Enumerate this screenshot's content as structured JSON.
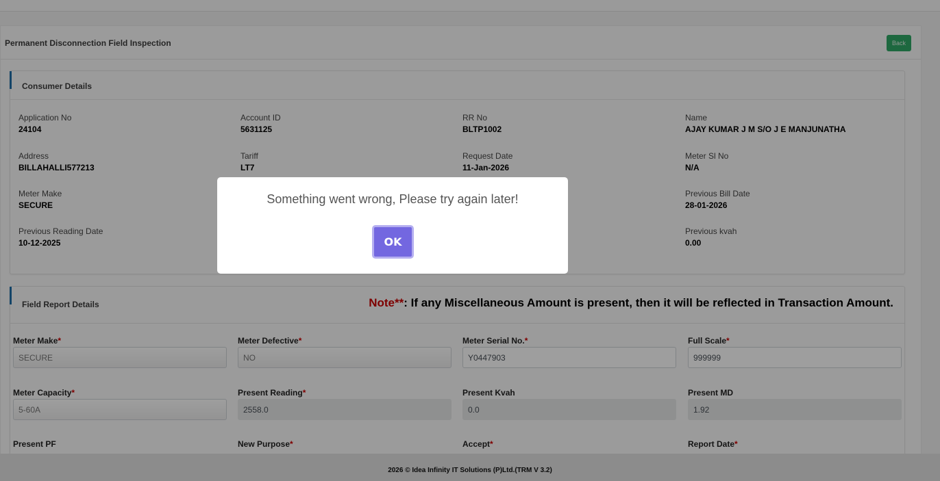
{
  "page": {
    "title": "Permanent Disconnection Field Inspection",
    "back_label": "Back"
  },
  "consumer": {
    "title": "Consumer Details",
    "fields": [
      {
        "label": "Application No",
        "value": "24104"
      },
      {
        "label": "Account ID",
        "value": "5631125"
      },
      {
        "label": "RR No",
        "value": "BLTP1002"
      },
      {
        "label": "Name",
        "value": "AJAY KUMAR J M S/O J E MANJUNATHA"
      },
      {
        "label": "Address",
        "value": "BILLAHALLI577213"
      },
      {
        "label": "Tariff",
        "value": "LT7"
      },
      {
        "label": "Request Date",
        "value": "11-Jan-2026"
      },
      {
        "label": "Meter Sl No",
        "value": "N/A"
      },
      {
        "label": "Meter Make",
        "value": "SECURE"
      },
      {
        "label": "Previous Bill Date",
        "value": "28-01-2026"
      },
      {
        "label": "Previous Reading Date",
        "value": "10-12-2025"
      },
      {
        "label": "Previous kvah",
        "value": "0.00"
      }
    ]
  },
  "field_report": {
    "title": "Field Report Details",
    "note_prefix": "Note**",
    "note_text": ": If any Miscellaneous Amount is present, then it will be reflected in Transaction Amount.",
    "fields": [
      {
        "label": "Meter Make",
        "req": "*",
        "value": "SECURE"
      },
      {
        "label": "Meter Defective",
        "req": "*",
        "value": "NO"
      },
      {
        "label": "Meter Serial No.",
        "req": "*",
        "value": "Y0447903"
      },
      {
        "label": "Full Scale",
        "req": "*",
        "value": "999999"
      },
      {
        "label": "Meter Capacity",
        "req": "*",
        "value": "5-60A"
      },
      {
        "label": "Present Reading",
        "req": "*",
        "value": "2558.0"
      },
      {
        "label": "Present Kvah",
        "req": "",
        "value": "0.0"
      },
      {
        "label": "Present MD",
        "req": "",
        "value": "1.92"
      },
      {
        "label": "Present PF",
        "req": ""
      },
      {
        "label": "New Purpose",
        "req": "*"
      },
      {
        "label": "Accept",
        "req": "*"
      },
      {
        "label": "Report Date",
        "req": "*"
      }
    ]
  },
  "footer": "2026 © Idea Infinity IT Solutions (P)Ltd.(TRM V 3.2)",
  "modal": {
    "message": "Something went wrong, Please try again later!",
    "ok_label": "OK"
  }
}
